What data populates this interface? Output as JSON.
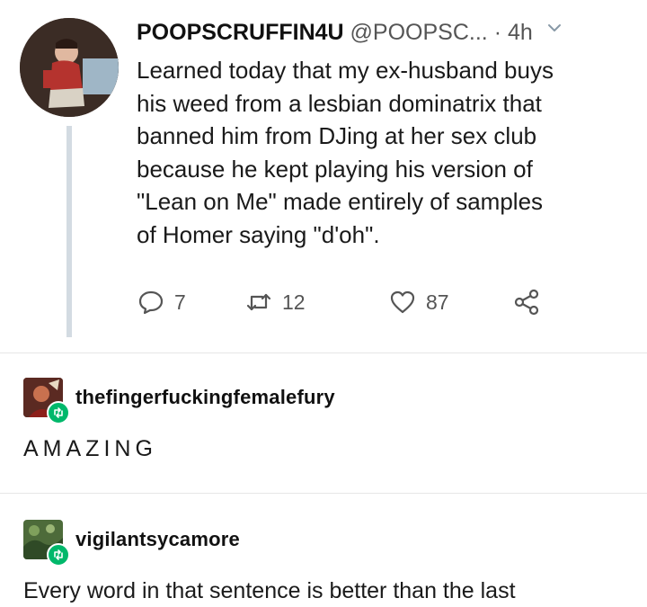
{
  "tweet": {
    "display_name": "POOPSCRUFFIN4U",
    "handle": "@POOPSC...",
    "time": "· 4h",
    "text": "Learned today that my ex-husband buys\nhis weed from a lesbian dominatrix that\nbanned him from DJing at her sex club\nbecause he kept playing his version of\n\"Lean on Me\" made entirely of samples\nof Homer saying \"d'oh\".",
    "replies": "7",
    "retweets": "12",
    "likes": "87"
  },
  "posts": [
    {
      "username": "thefingerfuckingfemalefury",
      "text": "AMAZING"
    },
    {
      "username": "vigilantsycamore",
      "text": "Every word in that sentence is better than the last"
    }
  ],
  "colors": {
    "reblog_badge": "#00b86b",
    "thread_line": "#d3dbe2",
    "icon_gray": "#555555"
  },
  "icons": [
    "chevron-down-icon",
    "reply-icon",
    "retweet-icon",
    "like-icon",
    "share-icon",
    "reblog-icon"
  ]
}
